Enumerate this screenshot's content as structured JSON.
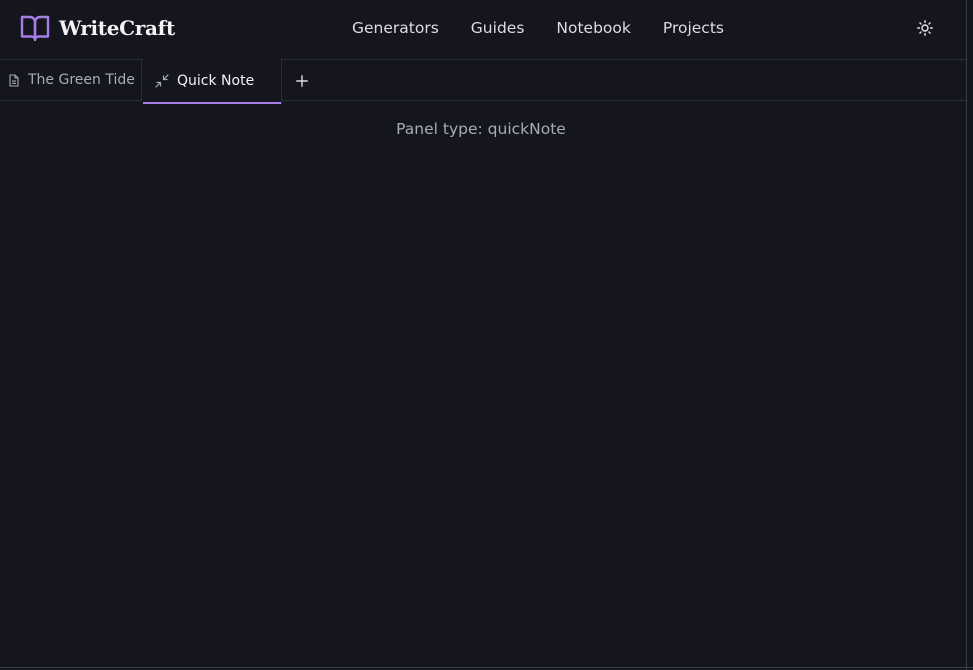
{
  "app": {
    "name": "WriteCraft",
    "accent_color": "#a77de6",
    "background_color": "#14151d"
  },
  "header": {
    "nav": [
      {
        "label": "Generators"
      },
      {
        "label": "Guides"
      },
      {
        "label": "Notebook"
      },
      {
        "label": "Projects"
      }
    ],
    "theme_toggle_icon": "sun-icon"
  },
  "tabs": [
    {
      "label": "The Green Tide",
      "icon": "document-icon",
      "active": false
    },
    {
      "label": "Quick Note",
      "icon": "minimize-icon",
      "active": true
    }
  ],
  "add_tab_icon": "plus-icon",
  "panel": {
    "text": "Panel type: quickNote"
  }
}
